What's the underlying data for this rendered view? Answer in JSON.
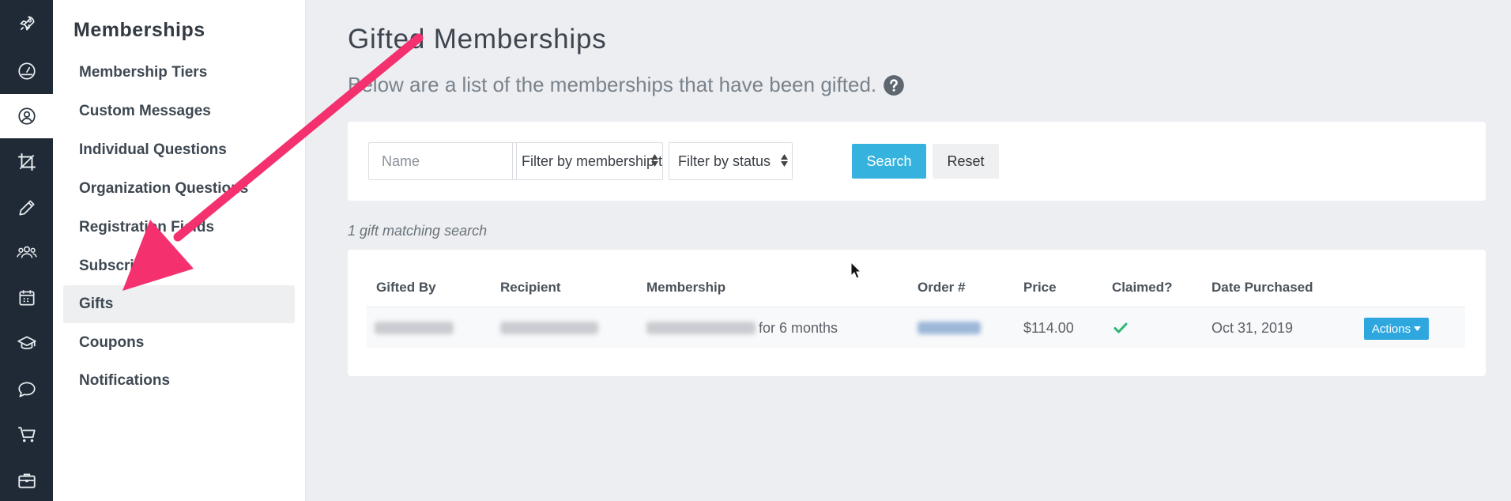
{
  "rail": {
    "items": [
      {
        "icon": "rocket-icon",
        "active": false
      },
      {
        "icon": "dashboard-icon",
        "active": false
      },
      {
        "icon": "user-circle-icon",
        "active": true
      },
      {
        "icon": "crop-icon",
        "active": false
      },
      {
        "icon": "pencil-icon",
        "active": false
      },
      {
        "icon": "people-icon",
        "active": false
      },
      {
        "icon": "calendar-icon",
        "active": false
      },
      {
        "icon": "graduation-cap-icon",
        "active": false
      },
      {
        "icon": "chat-icon",
        "active": false
      },
      {
        "icon": "cart-icon",
        "active": false
      },
      {
        "icon": "briefcase-icon",
        "active": false
      }
    ]
  },
  "submenu": {
    "title": "Memberships",
    "items": [
      {
        "label": "Membership Tiers"
      },
      {
        "label": "Custom Messages"
      },
      {
        "label": "Individual Questions"
      },
      {
        "label": "Organization Questions"
      },
      {
        "label": "Registration Fields"
      },
      {
        "label": "Subscriptions"
      },
      {
        "label": "Gifts"
      },
      {
        "label": "Coupons"
      },
      {
        "label": "Notifications"
      }
    ],
    "active_index": 6
  },
  "main": {
    "title": "Gifted Memberships",
    "subtitle": "Below are a list of the memberships that have been gifted.",
    "help_icon": "question-circle-icon"
  },
  "filters": {
    "name_placeholder": "Name",
    "tier_select": "Filter by membership tier",
    "status_select": "Filter by status",
    "search_label": "Search",
    "reset_label": "Reset"
  },
  "results": {
    "count_text": "1 gift matching search"
  },
  "table": {
    "headers": {
      "gifted_by": "Gifted By",
      "recipient": "Recipient",
      "membership": "Membership",
      "order": "Order #",
      "price": "Price",
      "claimed": "Claimed?",
      "date": "Date Purchased"
    },
    "rows": [
      {
        "membership_suffix": "for 6 months",
        "price": "$114.00",
        "claimed": true,
        "date": "Oct 31, 2019",
        "actions_label": "Actions"
      }
    ]
  },
  "colors": {
    "rail": "#1f2a36",
    "accent": "#35b3de",
    "actions": "#2ea7de",
    "arrow": "#f4306e",
    "check": "#2bb673"
  }
}
